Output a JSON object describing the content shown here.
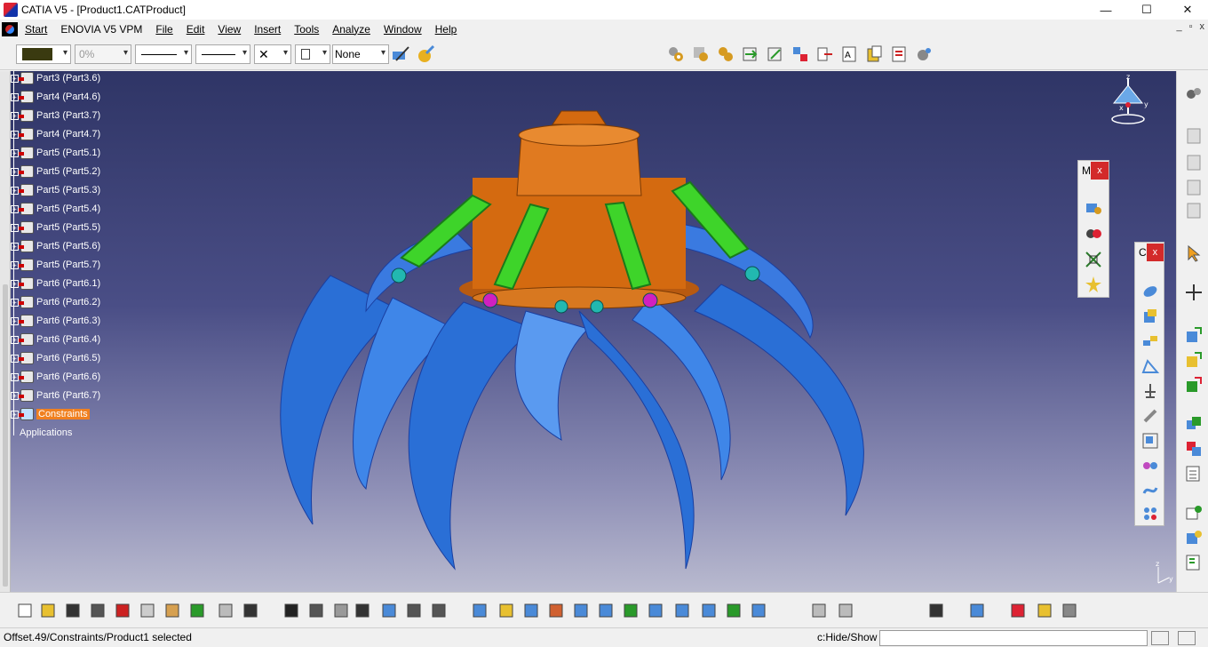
{
  "window": {
    "title": "CATIA V5 - [Product1.CATProduct]",
    "minimize": "—",
    "maximize": "☐",
    "close": "✕"
  },
  "menu": {
    "items": [
      "Start",
      "ENOVIA V5 VPM",
      "File",
      "Edit",
      "View",
      "Insert",
      "Tools",
      "Analyze",
      "Window",
      "Help"
    ],
    "mdi": [
      "_",
      "▫",
      "x"
    ]
  },
  "toolbar": {
    "color_value": "",
    "transparency_value": "0%",
    "layer_value": "None"
  },
  "tree": {
    "nodes": [
      "Part3 (Part3.6)",
      "Part4 (Part4.6)",
      "Part3 (Part3.7)",
      "Part4 (Part4.7)",
      "Part5 (Part5.1)",
      "Part5 (Part5.2)",
      "Part5 (Part5.3)",
      "Part5 (Part5.4)",
      "Part5 (Part5.5)",
      "Part5 (Part5.6)",
      "Part5 (Part5.7)",
      "Part6 (Part6.1)",
      "Part6 (Part6.2)",
      "Part6 (Part6.3)",
      "Part6 (Part6.4)",
      "Part6 (Part6.5)",
      "Part6 (Part6.6)",
      "Part6 (Part6.7)"
    ],
    "constraints_label": "Constraints",
    "applications_label": "Applications"
  },
  "palettes": {
    "first_title": "M",
    "second_title": "C",
    "close": "x"
  },
  "compass": {
    "z": "z",
    "x": "x",
    "y": "y"
  },
  "axis": {
    "z": "z",
    "y": "y"
  },
  "status": {
    "message": "Offset.49/Constraints/Product1 selected",
    "hint": "c:Hide/Show",
    "command": ""
  },
  "colors": {
    "viewport_top": "#2f3566",
    "viewport_bottom": "#b9bacf",
    "selection": "#f08020",
    "petal": "#2a6fd6",
    "hub": "#d46a10",
    "arm": "#3ed42a"
  }
}
